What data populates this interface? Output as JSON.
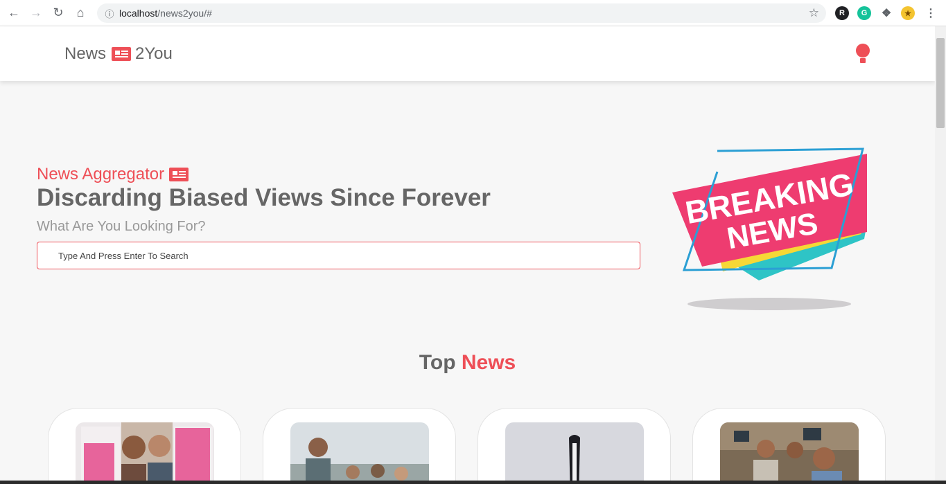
{
  "browser": {
    "url_host": "localhost",
    "url_path": "/news2you/#",
    "extensions": [
      "R",
      "G"
    ]
  },
  "header": {
    "logo_left": "News",
    "logo_right": "2You"
  },
  "hero": {
    "tagline": "News Aggregator",
    "title": "Discarding Biased Views Since Forever",
    "subtitle": "What Are You Looking For?",
    "search_placeholder": "Type And Press Enter To Search",
    "graphic_line1": "BREAKING",
    "graphic_line2": "NEWS"
  },
  "top_news": {
    "title_plain": "Top",
    "title_accent": "News"
  },
  "colors": {
    "accent": "#ee4f57",
    "text": "#666666"
  }
}
